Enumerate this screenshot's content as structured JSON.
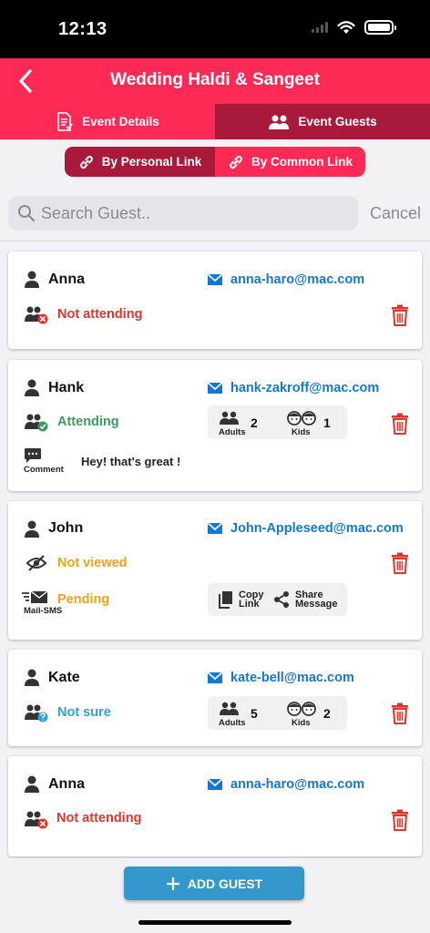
{
  "status_bar": {
    "time": "12:13"
  },
  "header": {
    "title": "Wedding Haldi & Sangeet"
  },
  "tabs": [
    {
      "label": "Event Details"
    },
    {
      "label": "Event Guests"
    }
  ],
  "segment": [
    {
      "label": "By Personal Link"
    },
    {
      "label": "By Common Link"
    }
  ],
  "search": {
    "placeholder": "Search Guest..",
    "value": "",
    "cancel_label": "Cancel"
  },
  "labels": {
    "comment": "Comment",
    "mail_sms": "Mail-SMS",
    "adults": "Adults",
    "kids": "Kids",
    "copy_link": [
      "Copy",
      "Link"
    ],
    "share_message": [
      "Share",
      "Message"
    ]
  },
  "colors": {
    "primary": "#fc2a55",
    "primary_dark": "#a8193a",
    "link": "#1577d4",
    "not_attending": "#e0342d",
    "attending": "#3c9a5f",
    "not_viewed": "#f0a020",
    "pending": "#f0a020",
    "not_sure": "#2aa5d6",
    "add_button": "#3498cc"
  },
  "guests": [
    {
      "name": "Anna",
      "email": "anna-haro@mac.com",
      "status": "Not attending"
    },
    {
      "name": "Hank",
      "email": "hank-zakroff@mac.com",
      "status": "Attending",
      "adults": "2",
      "kids": "1",
      "comment": "Hey! that's great !"
    },
    {
      "name": "John",
      "email": "John-Appleseed@mac.com",
      "status": "Not viewed",
      "status2": "Pending"
    },
    {
      "name": "Kate",
      "email": "kate-bell@mac.com",
      "status": "Not sure",
      "adults": "5",
      "kids": "2"
    },
    {
      "name": "Anna",
      "email": "anna-haro@mac.com",
      "status": "Not attending"
    }
  ],
  "add_button": {
    "label": "ADD GUEST"
  }
}
